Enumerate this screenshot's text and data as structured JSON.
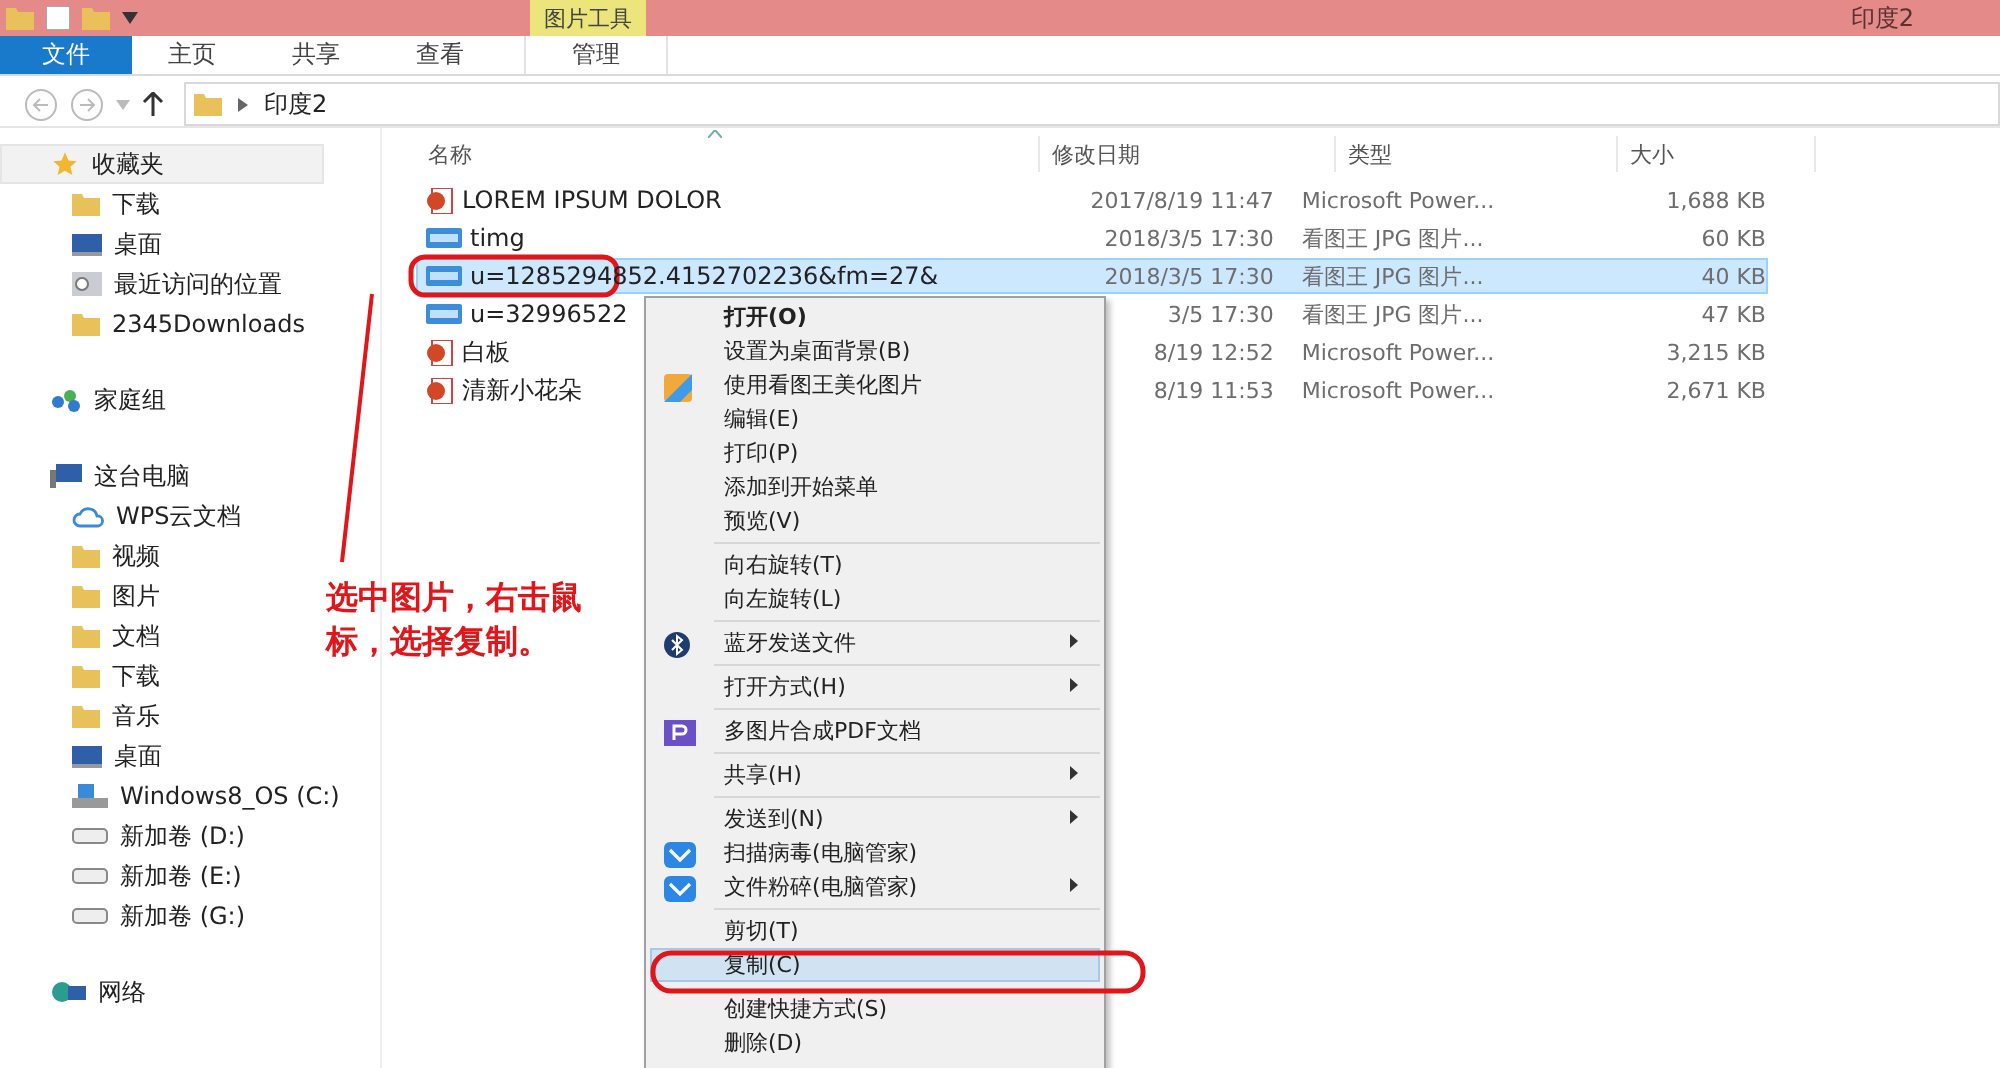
{
  "window": {
    "title": "印度2",
    "context_tab": "图片工具"
  },
  "ribbon_tabs": [
    {
      "label": "文件",
      "kind": "file"
    },
    {
      "label": "主页",
      "kind": "tab"
    },
    {
      "label": "共享",
      "kind": "tab"
    },
    {
      "label": "查看",
      "kind": "tab"
    },
    {
      "label": "管理",
      "kind": "context"
    }
  ],
  "address_bar": {
    "path": [
      "印度2"
    ]
  },
  "sidebar": {
    "items": [
      {
        "label": "收藏夹",
        "selected": true,
        "children": [
          {
            "label": "下载"
          },
          {
            "label": "桌面"
          },
          {
            "label": "最近访问的位置"
          },
          {
            "label": "2345Downloads"
          }
        ]
      },
      {
        "label": "家庭组",
        "selected": false
      },
      {
        "label": "这台电脑",
        "selected": false,
        "children": [
          {
            "label": "WPS云文档"
          },
          {
            "label": "视频"
          },
          {
            "label": "图片"
          },
          {
            "label": "文档"
          },
          {
            "label": "下载"
          },
          {
            "label": "音乐"
          },
          {
            "label": "桌面"
          },
          {
            "label": "Windows8_OS (C:)"
          },
          {
            "label": "新加卷 (D:)"
          },
          {
            "label": "新加卷 (E:)"
          },
          {
            "label": "新加卷 (G:)"
          }
        ]
      },
      {
        "label": "网络",
        "selected": false
      }
    ]
  },
  "file_list": {
    "columns": [
      "名称",
      "修改日期",
      "类型",
      "大小"
    ],
    "rows": [
      {
        "name": "LOREM IPSUM DOLOR",
        "date": "2017/8/19 11:47",
        "type": "Microsoft Power...",
        "size": "1,688 KB",
        "kind": "ppt",
        "selected": false
      },
      {
        "name": "timg",
        "date": "2018/3/5 17:30",
        "type": "看图王 JPG 图片...",
        "size": "60 KB",
        "kind": "jpg",
        "selected": false
      },
      {
        "name": "u=1285294852.4152702236&fm=27&",
        "date": "2018/3/5 17:30",
        "type": "看图王 JPG 图片...",
        "size": "40 KB",
        "kind": "jpg",
        "selected": true
      },
      {
        "name": "u=32996522",
        "date": "3/5 17:30",
        "type": "看图王 JPG 图片...",
        "size": "47 KB",
        "kind": "jpg",
        "selected": false
      },
      {
        "name": "白板",
        "date": "8/19 12:52",
        "type": "Microsoft Power...",
        "size": "3,215 KB",
        "kind": "ppt",
        "selected": false
      },
      {
        "name": "清新小花朵",
        "date": "8/19 11:53",
        "type": "Microsoft Power...",
        "size": "2,671 KB",
        "kind": "ppt",
        "selected": false
      }
    ]
  },
  "context_menu": [
    {
      "kind": "default",
      "label": "打开(O)",
      "selected": false,
      "submenu": false
    },
    {
      "kind": "item",
      "label": "设置为桌面背景(B)",
      "selected": false,
      "submenu": false
    },
    {
      "kind": "item",
      "label": "使用看图王美化图片",
      "selected": false,
      "submenu": false
    },
    {
      "kind": "item",
      "label": "编辑(E)",
      "selected": false,
      "submenu": false
    },
    {
      "kind": "item",
      "label": "打印(P)",
      "selected": false,
      "submenu": false
    },
    {
      "kind": "item",
      "label": "添加到开始菜单",
      "selected": false,
      "submenu": false
    },
    {
      "kind": "item",
      "label": "预览(V)",
      "selected": false,
      "submenu": false
    },
    {
      "kind": "separator"
    },
    {
      "kind": "item",
      "label": "向右旋转(T)",
      "selected": false,
      "submenu": false
    },
    {
      "kind": "item",
      "label": "向左旋转(L)",
      "selected": false,
      "submenu": false
    },
    {
      "kind": "separator"
    },
    {
      "kind": "item",
      "label": "蓝牙发送文件",
      "selected": false,
      "submenu": true
    },
    {
      "kind": "separator"
    },
    {
      "kind": "item",
      "label": "打开方式(H)",
      "selected": false,
      "submenu": true
    },
    {
      "kind": "separator"
    },
    {
      "kind": "item",
      "label": "多图片合成PDF文档",
      "selected": false,
      "submenu": false
    },
    {
      "kind": "separator"
    },
    {
      "kind": "item",
      "label": "共享(H)",
      "selected": false,
      "submenu": true
    },
    {
      "kind": "separator"
    },
    {
      "kind": "item",
      "label": "发送到(N)",
      "selected": false,
      "submenu": true
    },
    {
      "kind": "item",
      "label": "扫描病毒(电脑管家)",
      "selected": false,
      "submenu": false
    },
    {
      "kind": "item",
      "label": "文件粉碎(电脑管家)",
      "selected": false,
      "submenu": true
    },
    {
      "kind": "separator"
    },
    {
      "kind": "item",
      "label": "剪切(T)",
      "selected": false,
      "submenu": false
    },
    {
      "kind": "item",
      "label": "复制(C)",
      "selected": true,
      "submenu": false
    },
    {
      "kind": "item",
      "label": "创建快捷方式(S)",
      "selected": false,
      "submenu": false
    },
    {
      "kind": "item",
      "label": "删除(D)",
      "selected": false,
      "submenu": false
    }
  ],
  "annotation": {
    "text": "选中图片，右击鼠标，选择复制。"
  }
}
